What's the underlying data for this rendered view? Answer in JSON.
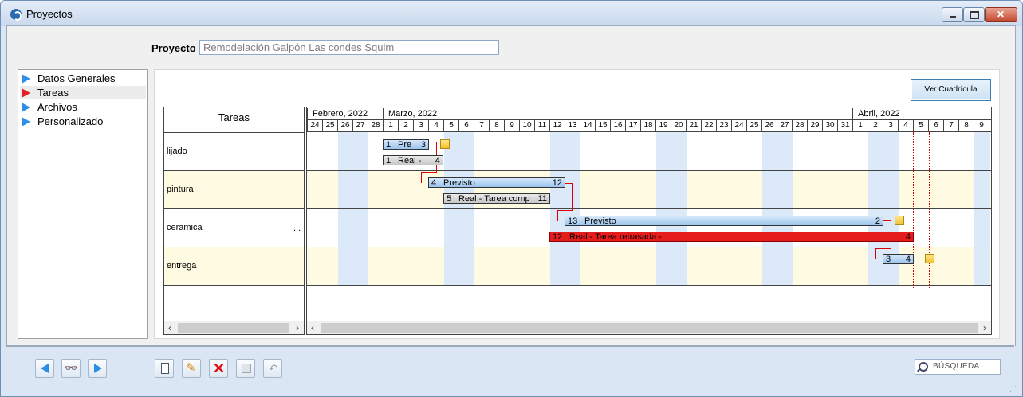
{
  "window": {
    "title": "Proyectos"
  },
  "project": {
    "label": "Proyecto",
    "value": "Remodelación Galpón Las condes Squim"
  },
  "nav": [
    {
      "label": "Datos Generales",
      "color": "#2f8fe5",
      "active": false
    },
    {
      "label": "Tareas",
      "color": "#e02020",
      "active": true
    },
    {
      "label": "Archivos",
      "color": "#2f8fe5",
      "active": false
    },
    {
      "label": "Personalizado",
      "color": "#2f8fe5",
      "active": false
    }
  ],
  "view_button": "Ver Cuadrícula",
  "gantt": {
    "header_label": "Tareas",
    "months": [
      "Febrero, 2022",
      "Marzo, 2022",
      "Abril, 2022"
    ],
    "days": [
      "24",
      "25",
      "26",
      "27",
      "28",
      "1",
      "2",
      "3",
      "4",
      "5",
      "6",
      "7",
      "8",
      "9",
      "10",
      "11",
      "12",
      "13",
      "14",
      "15",
      "16",
      "17",
      "18",
      "19",
      "20",
      "21",
      "22",
      "23",
      "24",
      "25",
      "26",
      "27",
      "28",
      "29",
      "30",
      "31",
      "1",
      "2",
      "3",
      "4",
      "5",
      "6",
      "7",
      "8",
      "9"
    ],
    "tasks": [
      {
        "name": "lijado",
        "more": ""
      },
      {
        "name": "pintura",
        "more": ""
      },
      {
        "name": "ceramica",
        "more": "..."
      },
      {
        "name": "entrega",
        "more": ""
      }
    ],
    "bars": [
      {
        "kind": "plan",
        "start": "1",
        "text": "Pre",
        "end": "3"
      },
      {
        "kind": "real",
        "start": "1",
        "text": "Real  -",
        "end": "4"
      },
      {
        "kind": "plan",
        "start": "4",
        "text": "Previsto",
        "end": "12"
      },
      {
        "kind": "real",
        "start": "5",
        "text": "Real  -  Tarea comp",
        "end": "11"
      },
      {
        "kind": "plan",
        "start": "13",
        "text": "Previsto",
        "end": "2"
      },
      {
        "kind": "late",
        "start": "12",
        "text": "Real  -  Tarea retrasada  -",
        "end": "4"
      },
      {
        "kind": "plan",
        "start": "3",
        "text": "",
        "end": "4"
      }
    ]
  },
  "footer": {
    "search_placeholder": "BÚSQUEDA"
  },
  "colors": {
    "weekend": "#dce9f8",
    "alt_row": "#fffbe2",
    "late": "#e41c1c",
    "accent": "#2f8fe5"
  }
}
